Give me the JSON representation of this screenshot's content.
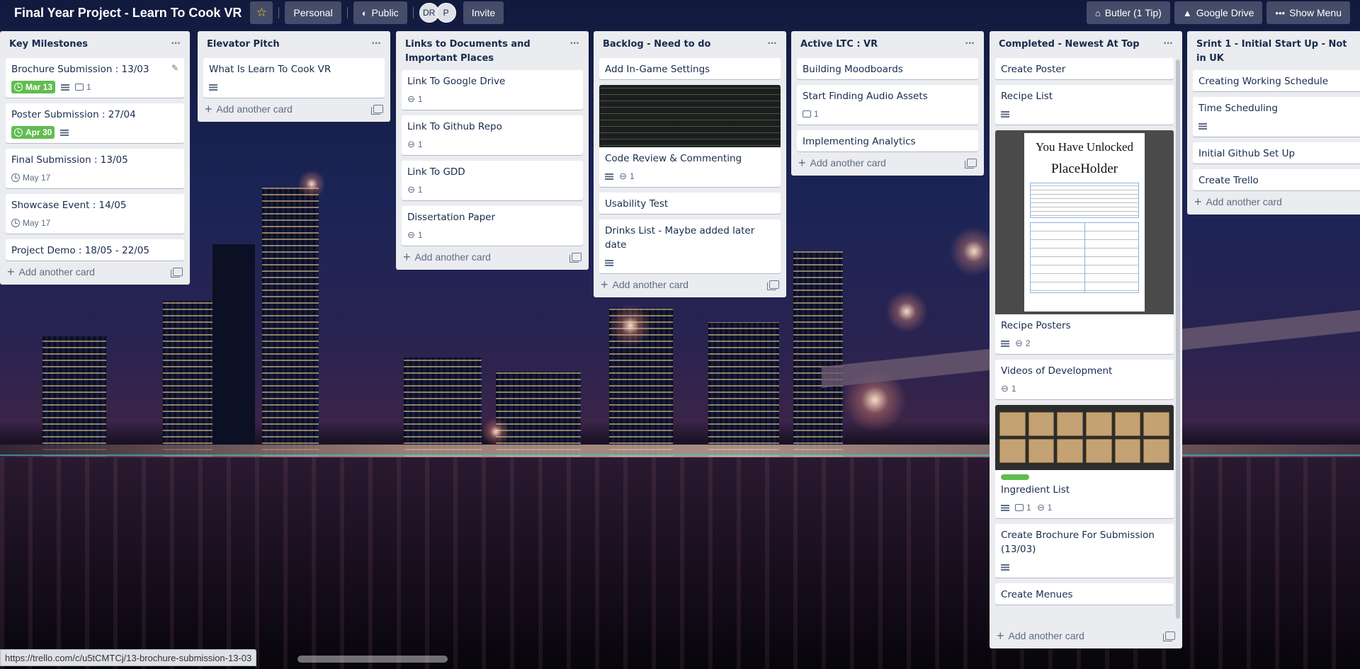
{
  "header": {
    "board_title": "Final Year Project - Learn To Cook VR",
    "personal_label": "Personal",
    "public_label": "Public",
    "members": [
      "DR",
      "P"
    ],
    "invite_label": "Invite",
    "butler_label": "Butler (1 Tip)",
    "drive_label": "Google Drive",
    "show_menu_label": "Show Menu"
  },
  "add_card_label": "Add another card",
  "lists": [
    {
      "title": "Key Milestones",
      "cards": [
        {
          "title": "Brochure Submission : 13/03",
          "due": "Mar 13",
          "desc": true,
          "comments": "1"
        },
        {
          "title": "Poster Submission : 27/04",
          "due": "Apr 30",
          "desc": true
        },
        {
          "title": "Final Submission : 13/05",
          "date": "May 17"
        },
        {
          "title": "Showcase Event : 14/05",
          "date": "May 17"
        },
        {
          "title": "Project Demo : 18/05 - 22/05"
        }
      ]
    },
    {
      "title": "Elevator Pitch",
      "cards": [
        {
          "title": "What Is Learn To Cook VR",
          "desc": true
        }
      ]
    },
    {
      "title": "Links to Documents and Important Places",
      "cards": [
        {
          "title": "Link To Google Drive",
          "attachments": "1"
        },
        {
          "title": "Link To Github Repo",
          "attachments": "1"
        },
        {
          "title": "Link To GDD",
          "attachments": "1"
        },
        {
          "title": "Dissertation Paper",
          "attachments": "1"
        }
      ]
    },
    {
      "title": "Backlog - Need to do",
      "cards": [
        {
          "title": "Add In-Game Settings"
        },
        {
          "title": "Code Review & Commenting",
          "desc": true,
          "attachments": "1",
          "cover": "code"
        },
        {
          "title": "Usability Test"
        },
        {
          "title": "Drinks List - Maybe added later date",
          "desc": true
        }
      ]
    },
    {
      "title": "Active LTC : VR",
      "cards": [
        {
          "title": "Building Moodboards"
        },
        {
          "title": "Start Finding Audio Assets",
          "comments": "1"
        },
        {
          "title": "Implementing Analytics"
        }
      ]
    },
    {
      "title": "Completed - Newest At Top",
      "cards": [
        {
          "title": "Create Poster"
        },
        {
          "title": "Recipe List",
          "desc": true
        },
        {
          "title": "Recipe Posters",
          "desc": true,
          "attachments": "2",
          "cover": "poster"
        },
        {
          "title": "Videos of Development",
          "attachments": "1"
        },
        {
          "title": "Ingredient List",
          "desc": true,
          "comments": "1",
          "attachments": "1",
          "cover": "boxes",
          "label": "#61bd4f"
        },
        {
          "title": "Create Brochure For Submission (13/03)",
          "desc": true
        },
        {
          "title": "Create Menues"
        }
      ]
    },
    {
      "title": "Srint 1 - Initial Start Up - Not in UK",
      "cards": [
        {
          "title": "Creating Working Schedule"
        },
        {
          "title": "Time Scheduling",
          "desc": true
        },
        {
          "title": "Initial Github Set Up"
        },
        {
          "title": "Create Trello"
        }
      ]
    }
  ],
  "poster_cover": {
    "heading": "You Have Unlocked",
    "subheading": "PlaceHolder"
  },
  "status_url": "https://trello.com/c/u5tCMTCj/13-brochure-submission-13-03",
  "colors": {
    "due_green": "#61bd4f",
    "list_bg": "#ebecf0",
    "star": "#f2d600"
  }
}
